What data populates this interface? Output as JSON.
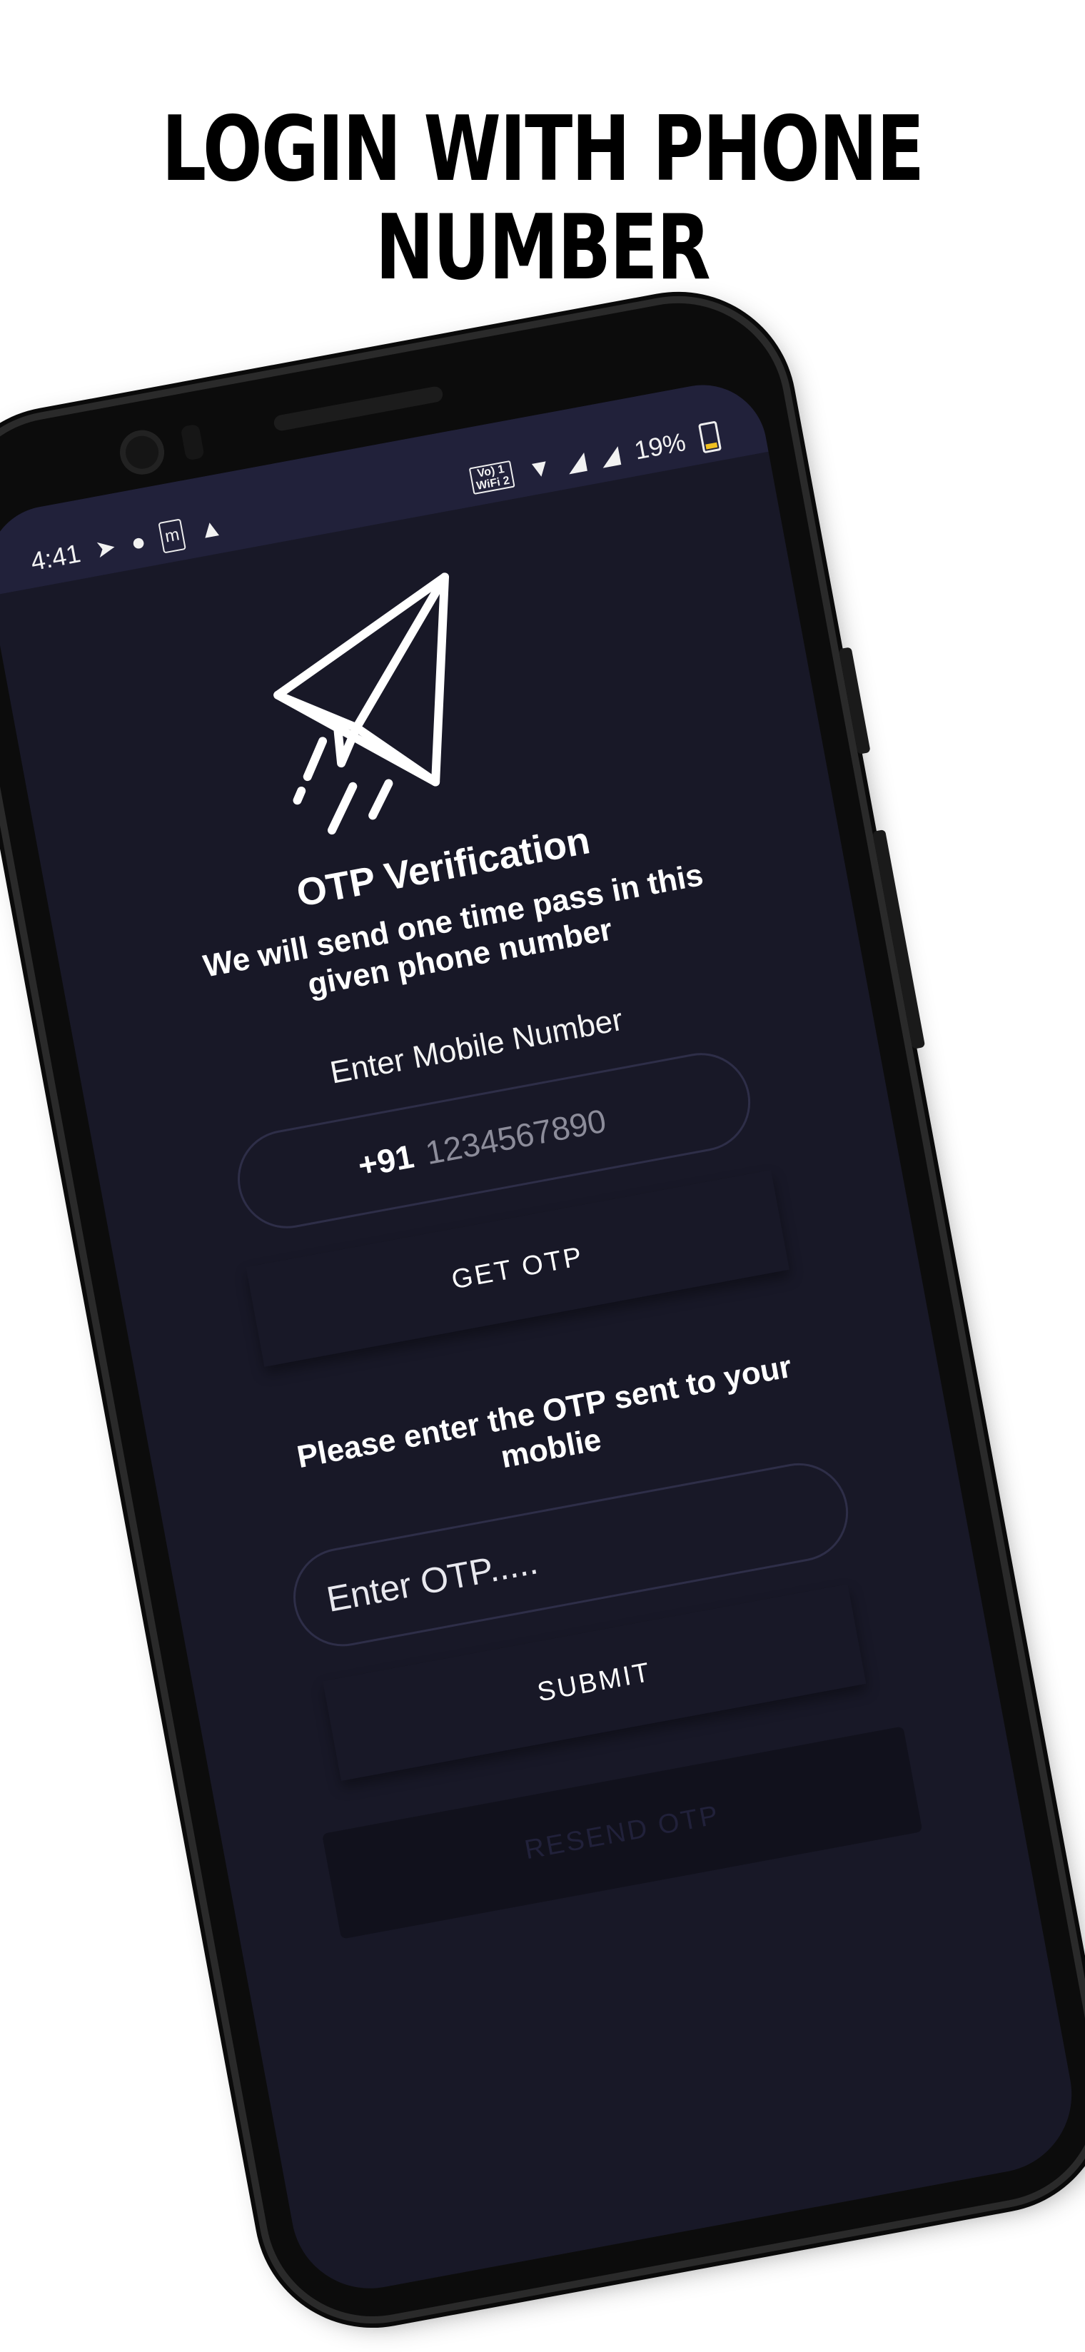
{
  "headline": [
    "LOGIN WITH PHONE",
    "NUMBER"
  ],
  "statusbar": {
    "time": "4:41",
    "left_icons": [
      "send-icon",
      "app-icon",
      "m-icon",
      "triangle-icon"
    ],
    "volte": "Vo) 1\nWiFi 2",
    "battery": "19%"
  },
  "screen": {
    "title": "OTP Verification",
    "subtitle": "We will send one time pass in this given phone number",
    "mobile_label": "Enter Mobile Number",
    "country_code": "+91",
    "phone_placeholder": "1234567890",
    "get_otp_label": "GET OTP",
    "otp_prompt": "Please enter the OTP sent to your moblie",
    "otp_placeholder": "Enter OTP.....",
    "submit_label": "SUBMIT",
    "resend_label": "RESEND OTP"
  },
  "colors": {
    "screen_bg": "#181827",
    "statusbar_bg": "#21213a",
    "field_border": "#2e2e48",
    "text": "#ffffff"
  }
}
